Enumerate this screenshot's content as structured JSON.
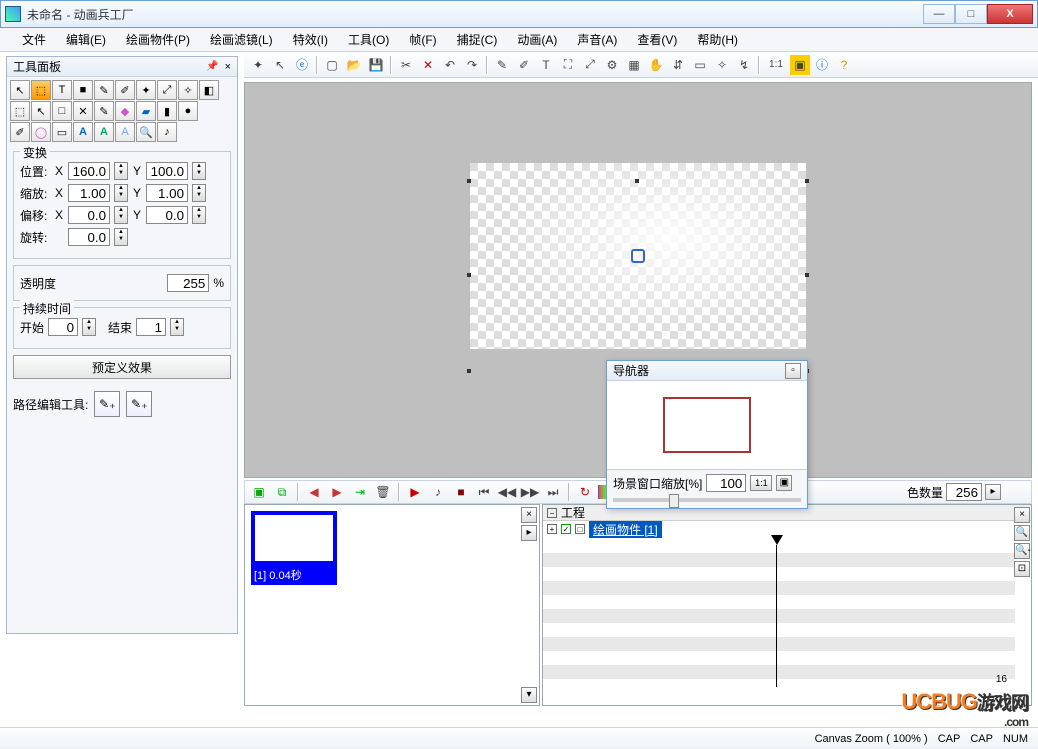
{
  "title": "未命名 - 动画兵工厂",
  "menus": [
    "文件",
    "编辑(E)",
    "绘画物件(P)",
    "绘画滤镜(L)",
    "特效(I)",
    "工具(O)",
    "帧(F)",
    "捕捉(C)",
    "动画(A)",
    "声音(A)",
    "查看(V)",
    "帮助(H)"
  ],
  "tools_panel_title": "工具面板",
  "transform": {
    "title": "变换",
    "pos_label": "位置:",
    "scale_label": "缩放:",
    "offset_label": "偏移:",
    "rotate_label": "旋转:",
    "x": "X",
    "y": "Y",
    "pos_x": "160.0",
    "pos_y": "100.0",
    "scale_x": "1.00",
    "scale_y": "1.00",
    "off_x": "0.0",
    "off_y": "0.0",
    "rotate": "0.0"
  },
  "opacity": {
    "label": "透明度",
    "value": "255",
    "pct": "%"
  },
  "duration": {
    "title": "持续时间",
    "start_label": "开始",
    "start": "0",
    "end_label": "结束",
    "end": "1"
  },
  "preset_btn": "预定义效果",
  "path_label": "路径编辑工具:",
  "frame_label": "[1] 0.04秒",
  "timeline": {
    "project": "工程",
    "object": "绘画物件  [1]",
    "tick": "16"
  },
  "colorcount": {
    "label": "色数量",
    "value": "256"
  },
  "navigator": {
    "title": "导航器",
    "zoom_label": "场景窗口缩放[%]",
    "zoom": "100",
    "onetoone": "1:1"
  },
  "status": {
    "zoom": "Canvas Zoom ( 100% )",
    "cap1": "CAP",
    "cap2": "CAP",
    "num": "NUM"
  },
  "watermark": {
    "brand": "UCBUG",
    "suffix": "游戏网",
    "dom": ".com"
  },
  "icons": {
    "min": "—",
    "max": "□",
    "close": "X",
    "onetoone": "1:1"
  }
}
